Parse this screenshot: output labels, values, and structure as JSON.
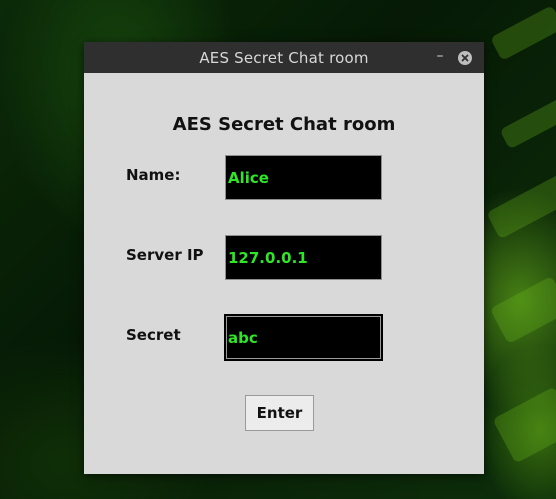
{
  "window": {
    "title": "AES Secret Chat room",
    "minimize_glyph": "–"
  },
  "form": {
    "heading": "AES Secret Chat room",
    "name_label": "Name:",
    "name_value": "Alice",
    "server_label": "Server IP",
    "server_value": "127.0.0.1",
    "secret_label": "Secret",
    "secret_value": "abc",
    "enter_label": "Enter"
  },
  "colors": {
    "input_bg": "#000000",
    "input_text": "#2ee626",
    "window_bg": "#d9d9d9",
    "titlebar_bg": "#2f2f2f"
  },
  "icons": {
    "minimize": "minimize-icon",
    "close": "close-icon"
  }
}
